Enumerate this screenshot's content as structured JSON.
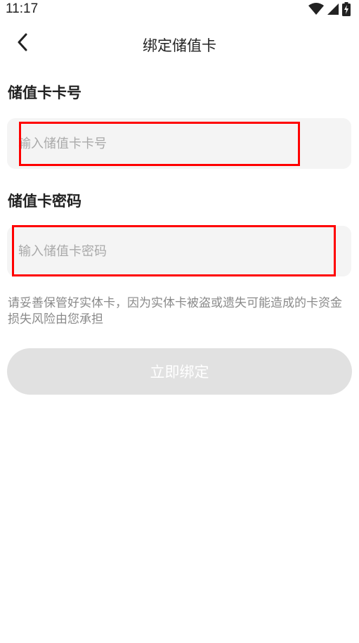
{
  "status_bar": {
    "time": "11:17",
    "icons": [
      "wifi-icon",
      "signal-icon",
      "battery-charging-icon"
    ]
  },
  "header": {
    "title": "绑定储值卡",
    "back_icon": "chevron-left-icon"
  },
  "form": {
    "card_number": {
      "label": "储值卡卡号",
      "value": "",
      "placeholder": "输入储值卡卡号"
    },
    "card_password": {
      "label": "储值卡密码",
      "value": "",
      "placeholder": "输入储值卡密码"
    },
    "notice": "请妥善保管好实体卡，因为实体卡被盗或遗失可能造成的卡资金损失风险由您承担",
    "submit_label": "立即绑定"
  },
  "colors": {
    "input_background": "#f4f4f4",
    "placeholder": "#a9a9a9",
    "notice_text": "#8a8a8a",
    "button_disabled_background": "#e1e1e1",
    "button_text": "#ffffff",
    "highlight": "#ff0000"
  }
}
